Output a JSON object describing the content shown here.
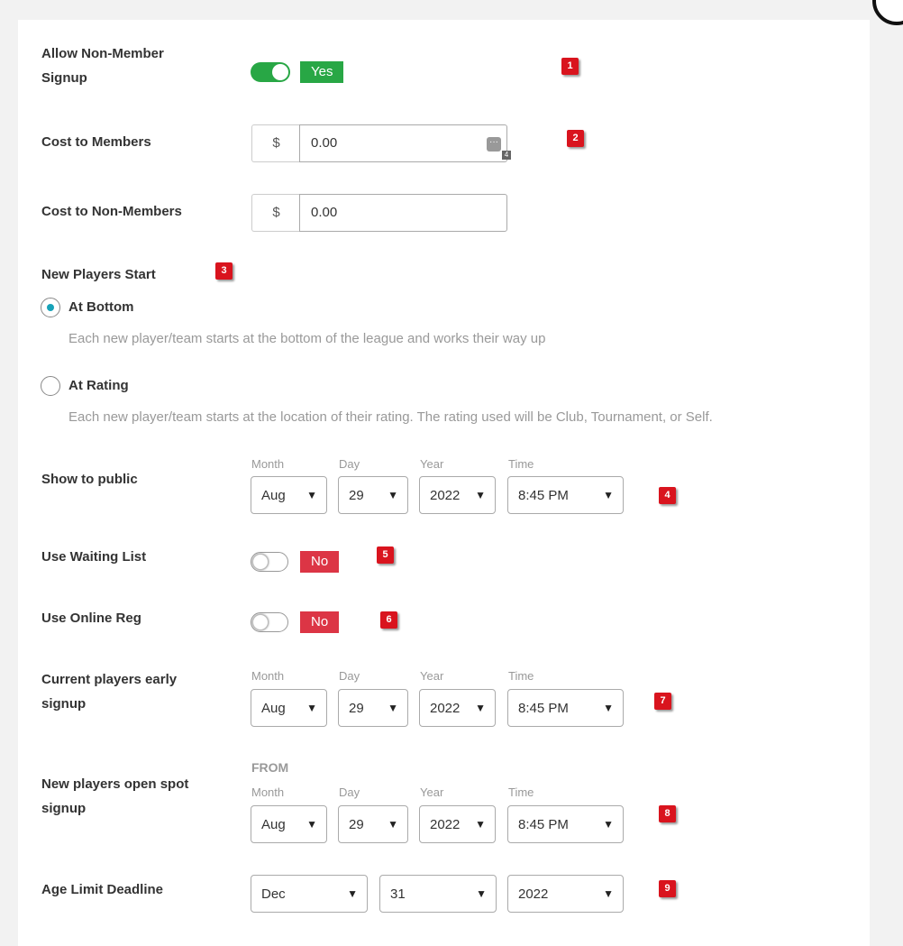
{
  "allow_nonmember": {
    "label_line1": "Allow Non-Member",
    "label_line2": "Signup",
    "status": "Yes"
  },
  "cost_members": {
    "label": "Cost to Members",
    "currency": "$",
    "value": "0.00",
    "more_count": "4"
  },
  "cost_nonmembers": {
    "label": "Cost to Non-Members",
    "currency": "$",
    "value": "0.00"
  },
  "new_players_start": {
    "label": "New Players Start",
    "options": [
      {
        "label": "At Bottom",
        "description": "Each new player/team starts at the bottom of the league and works their way up",
        "selected": true
      },
      {
        "label": "At Rating",
        "description": "Each new player/team starts at the location of their rating. The rating used will be Club, Tournament, or Self.",
        "selected": false
      }
    ]
  },
  "field_labels": {
    "month": "Month",
    "day": "Day",
    "year": "Year",
    "time": "Time"
  },
  "show_public": {
    "label": "Show to public",
    "month": "Aug",
    "day": "29",
    "year": "2022",
    "time": "8:45 PM"
  },
  "waiting_list": {
    "label": "Use Waiting List",
    "status": "No"
  },
  "online_reg": {
    "label": "Use Online Reg",
    "status": "No"
  },
  "early_signup": {
    "label_line1": "Current players early",
    "label_line2": "signup",
    "month": "Aug",
    "day": "29",
    "year": "2022",
    "time": "8:45 PM"
  },
  "open_spot": {
    "label_line1": "New players open spot",
    "label_line2": "signup",
    "from": "FROM",
    "month": "Aug",
    "day": "29",
    "year": "2022",
    "time": "8:45 PM"
  },
  "age_limit": {
    "label": "Age Limit Deadline",
    "month": "Dec",
    "day": "31",
    "year": "2022"
  },
  "markers": [
    "1",
    "2",
    "3",
    "4",
    "5",
    "6",
    "7",
    "8",
    "9"
  ],
  "colors": {
    "on": "#28a745",
    "off": "#dc3545",
    "radio": "#17a2b8",
    "marker": "#d9141e"
  }
}
